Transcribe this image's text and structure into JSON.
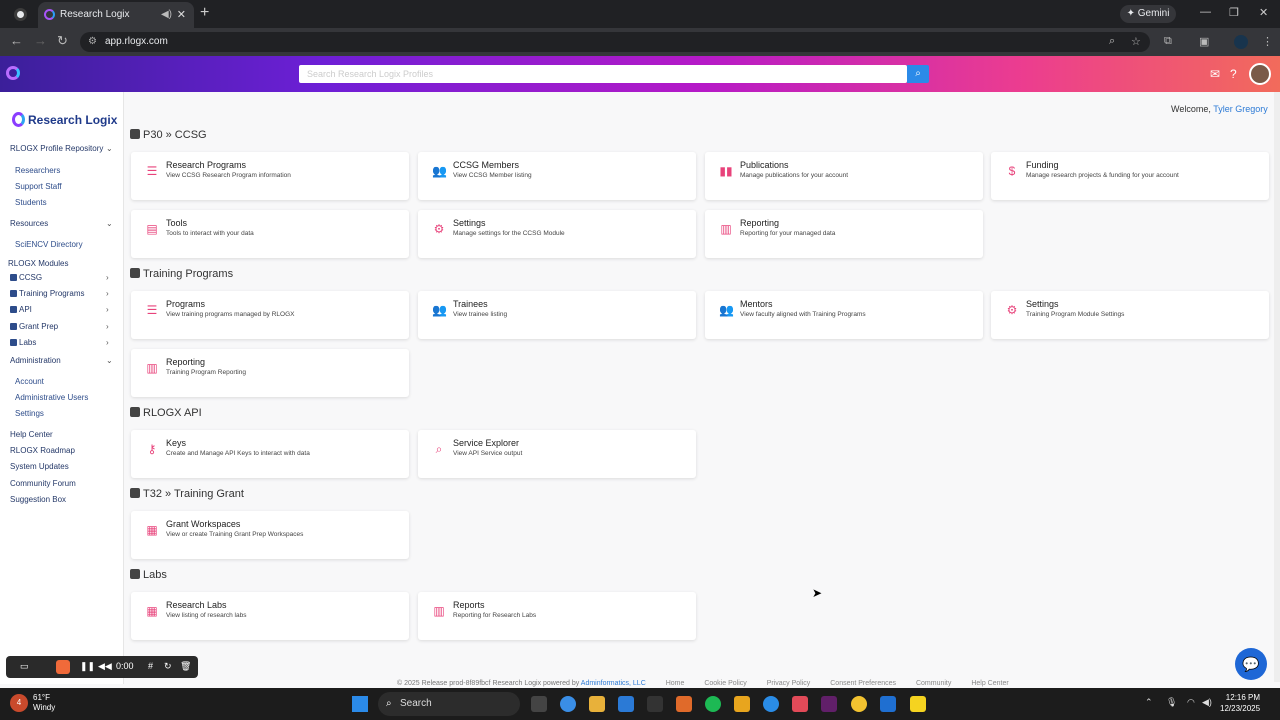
{
  "browser": {
    "tab_title": "Research Logix",
    "url": "app.rlogx.com",
    "gemini_label": "Gemini"
  },
  "app": {
    "search_placeholder": "Search Research Logix Profiles",
    "welcome": "Welcome,",
    "user_name": "Tyler Gregory"
  },
  "sidebar": {
    "brand": "Research Logix",
    "profile_repo": "RLOGX Profile Repository",
    "repo_items": [
      "Researchers",
      "Support Staff",
      "Students"
    ],
    "resources": "Resources",
    "resources_items": [
      "SciENCV Directory"
    ],
    "modules_header": "RLOGX Modules",
    "modules": [
      "CCSG",
      "Training Programs",
      "API",
      "Grant Prep",
      "Labs"
    ],
    "administration": "Administration",
    "admin_items": [
      "Account",
      "Administrative Users",
      "Settings"
    ],
    "bottom_links": [
      "Help Center",
      "RLOGX Roadmap",
      "System Updates",
      "Community Forum",
      "Suggestion Box"
    ]
  },
  "sections": [
    {
      "title": "P30 » CCSG",
      "cards": [
        {
          "title": "Research Programs",
          "desc": "View CCSG Research Program information",
          "icon": "list-icon"
        },
        {
          "title": "CCSG Members",
          "desc": "View CCSG Member listing",
          "icon": "users-icon"
        },
        {
          "title": "Publications",
          "desc": "Manage publications for your account",
          "icon": "book-icon"
        },
        {
          "title": "Funding",
          "desc": "Manage research projects & funding for your account",
          "icon": "dollar-icon"
        },
        {
          "title": "Tools",
          "desc": "Tools to interact with your data",
          "icon": "toolbox-icon"
        },
        {
          "title": "Settings",
          "desc": "Manage settings for the CCSG Module",
          "icon": "gear-icon"
        },
        {
          "title": "Reporting",
          "desc": "Reporting for your managed data",
          "icon": "chart-icon"
        }
      ]
    },
    {
      "title": "Training Programs",
      "cards": [
        {
          "title": "Programs",
          "desc": "View training programs managed by RLOGX",
          "icon": "list-icon"
        },
        {
          "title": "Trainees",
          "desc": "View trainee listing",
          "icon": "users-icon"
        },
        {
          "title": "Mentors",
          "desc": "View faculty aligned with Training Programs",
          "icon": "users-icon"
        },
        {
          "title": "Settings",
          "desc": "Training Program Module Settings",
          "icon": "gear-icon"
        },
        {
          "title": "Reporting",
          "desc": "Training Program Reporting",
          "icon": "chart-icon"
        }
      ]
    },
    {
      "title": "RLOGX API",
      "cards": [
        {
          "title": "Keys",
          "desc": "Create and Manage API Keys to interact with data",
          "icon": "key-icon"
        },
        {
          "title": "Service Explorer",
          "desc": "View API Service output",
          "icon": "search-icon"
        }
      ]
    },
    {
      "title": "T32 » Training Grant",
      "cards": [
        {
          "title": "Grant Workspaces",
          "desc": "View or create Training Grant Prep Workspaces",
          "icon": "grid-icon"
        }
      ]
    },
    {
      "title": "Labs",
      "cards": [
        {
          "title": "Research Labs",
          "desc": "View listing of research labs",
          "icon": "grid-icon"
        },
        {
          "title": "Reports",
          "desc": "Reporting for Research Labs",
          "icon": "chart-icon"
        }
      ]
    }
  ],
  "footer": {
    "copyright": "© 2025 Release prod-8f89fbcf Research Logix powered by",
    "company": "Adminformatics, LLC",
    "links": [
      "Home",
      "Cookie Policy",
      "Privacy Policy",
      "Consent Preferences",
      "Community",
      "Help Center"
    ]
  },
  "recorder": {
    "time": "0:00"
  },
  "taskbar": {
    "temp": "61°F",
    "weather": "Windy",
    "search": "Search",
    "time": "12:16 PM",
    "date": "12/23/2025",
    "badge": "4"
  }
}
